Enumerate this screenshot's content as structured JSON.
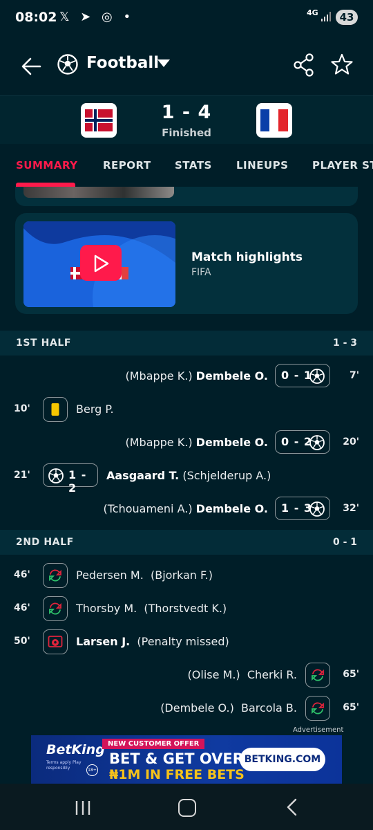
{
  "status_bar": {
    "time": "08:02",
    "apps": "𝕏 ➤ ◎ •",
    "network": "4G",
    "battery": "43"
  },
  "app_bar": {
    "sport": "Football"
  },
  "match": {
    "score": "1 - 4",
    "status": "Finished"
  },
  "tabs": [
    {
      "label": "SUMMARY",
      "active": true
    },
    {
      "label": "REPORT"
    },
    {
      "label": "STATS"
    },
    {
      "label": "LINEUPS"
    },
    {
      "label": "PLAYER STATS"
    }
  ],
  "highlights": {
    "title": "Match highlights",
    "source": "FIFA"
  },
  "first_half": {
    "label": "1ST HALF",
    "score": "1 - 3",
    "events": [
      {
        "minute": "7'",
        "side": "away",
        "type": "goal",
        "assist": "(Mbappe K.)",
        "player": "Dembele O.",
        "score": "0 - 1"
      },
      {
        "minute": "10'",
        "side": "home",
        "type": "yellow-card",
        "player": "Berg P."
      },
      {
        "minute": "20'",
        "side": "away",
        "type": "goal",
        "assist": "(Mbappe K.)",
        "player": "Dembele O.",
        "score": "0 - 2"
      },
      {
        "minute": "21'",
        "side": "home",
        "type": "goal",
        "assist": "(Schjelderup A.)",
        "player": "Aasgaard T.",
        "score": "1 - 2"
      },
      {
        "minute": "32'",
        "side": "away",
        "type": "goal",
        "assist": "(Tchouameni A.)",
        "player": "Dembele O.",
        "score": "1 - 3"
      }
    ]
  },
  "second_half": {
    "label": "2ND HALF",
    "score": "0 - 1",
    "events": [
      {
        "minute": "46'",
        "side": "home",
        "type": "substitution",
        "player": "Pedersen M.",
        "other": "(Bjorkan F.)"
      },
      {
        "minute": "46'",
        "side": "home",
        "type": "substitution",
        "player": "Thorsby M.",
        "other": "(Thorstvedt K.)"
      },
      {
        "minute": "50'",
        "side": "home",
        "type": "penalty-missed",
        "player": "Larsen J.",
        "other": "(Penalty missed)"
      },
      {
        "minute": "65'",
        "side": "away",
        "type": "substitution",
        "player": "Cherki R.",
        "other": "(Olise M.)"
      },
      {
        "minute": "65'",
        "side": "away",
        "type": "substitution",
        "player": "Barcola B.",
        "other": "(Dembele O.)"
      }
    ]
  },
  "ad": {
    "label": "Advertisement",
    "brand": "BetKing",
    "fineprint": "Terms apply Play responsibly",
    "age": "18+",
    "offer": "NEW CUSTOMER OFFER",
    "headline": "BET & GET OVER",
    "headline2": "₦1M IN FREE BETS",
    "cta": "BETKING.COM"
  },
  "colors": {
    "accent": "#ff1a4b",
    "background": "#001e28",
    "card": "#03303c",
    "section": "#032c38"
  }
}
